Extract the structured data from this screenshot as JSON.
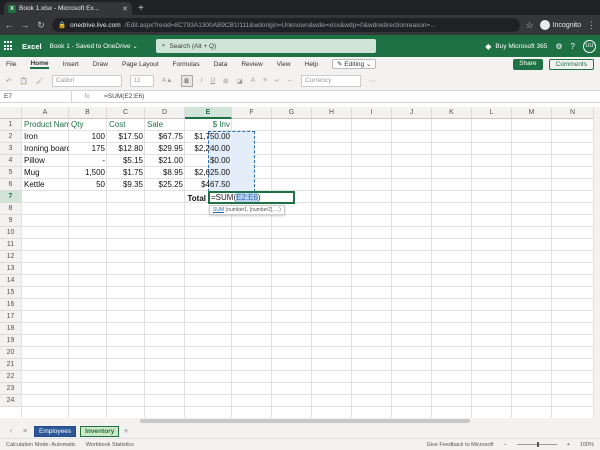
{
  "browser": {
    "tab_title": "Book 1.xlsx - Microsoft Ex...",
    "url_host": "onedrive.live.com",
    "url_rest": "/Edit.aspx?resid=8C793A1300AB9CB1!111&wdorigin=Unknown&wde=xlsx&wdp=0&wdredirectionreason=...",
    "incognito_label": "Incognito"
  },
  "excel": {
    "app_name": "Excel",
    "doc_title": "Book 1 - Saved to OneDrive ⌄",
    "search_placeholder": "Search (Alt + Q)",
    "buy_label": "Buy Microsoft 365",
    "avatar": "UU"
  },
  "menu": {
    "items": [
      "File",
      "Home",
      "Insert",
      "Draw",
      "Page Layout",
      "Formulas",
      "Data",
      "Review",
      "View",
      "Help"
    ],
    "editing_label": "✎ Editing ⌄",
    "share_label": "Share",
    "comments_label": "Comments"
  },
  "toolbar": {
    "font_name": "Calibri",
    "font_size": "11",
    "bold": "B",
    "number_format": "Currency"
  },
  "formula_bar": {
    "name_box": "E7",
    "fx": "fx",
    "formula": "=SUM(E2:E6)"
  },
  "columns": [
    "A",
    "B",
    "C",
    "D",
    "E",
    "F",
    "G",
    "H",
    "I",
    "J",
    "K",
    "L",
    "M",
    "N"
  ],
  "rows": [
    "1",
    "2",
    "3",
    "4",
    "5",
    "6",
    "7",
    "8",
    "9",
    "10",
    "11",
    "12",
    "13",
    "14",
    "15",
    "16",
    "17",
    "18",
    "19",
    "20",
    "21",
    "22",
    "23",
    "24"
  ],
  "table": {
    "headers": [
      "Product Name",
      "Qty",
      "Cost",
      "Sale",
      "$ Inv"
    ],
    "data": [
      [
        "Iron",
        "100",
        "$17.50",
        "$67.75",
        "$1,750.00"
      ],
      [
        "Ironing board",
        "175",
        "$12.80",
        "$29.95",
        "$2,240.00"
      ],
      [
        "Pillow",
        "-",
        "$5.15",
        "$21.00",
        "$0.00"
      ],
      [
        "Mug",
        "1,500",
        "$1.75",
        "$8.95",
        "$2,625.00"
      ],
      [
        "Kettle",
        "50",
        "$9.35",
        "$25.25",
        "$467.50"
      ]
    ],
    "total_label": "Total"
  },
  "active_cell": {
    "prefix": "=SUM(",
    "ref": "E2:E6",
    "suffix": ")",
    "tooltip_fn": "SUM",
    "tooltip_args": "(number1, [number2], ...)"
  },
  "sheets": {
    "tabs": [
      "Employees",
      "Inventory"
    ],
    "active": "Inventory",
    "add": "+"
  },
  "status": {
    "calc_mode": "Calculation Mode: Automatic",
    "stats": "Workbook Statistics",
    "feedback": "Give Feedback to Microsoft",
    "zoom": "100%"
  },
  "colors": {
    "excel_green": "#1e7145",
    "range_blue": "#2b6cb0",
    "header_text": "#1e7145"
  }
}
